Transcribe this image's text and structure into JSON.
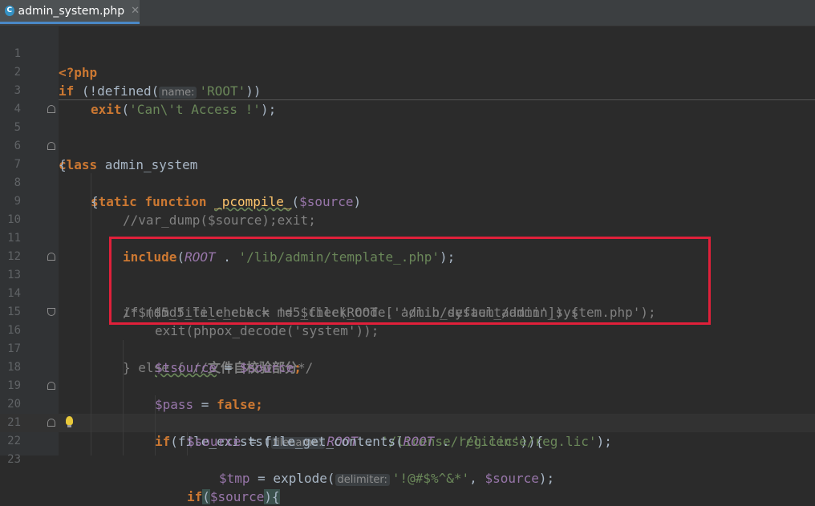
{
  "tab": {
    "filename": "admin_system.php",
    "icon_letter": "C"
  },
  "line_numbers": [
    "1",
    "2",
    "3",
    "4",
    "5",
    "6",
    "7",
    "8",
    "9",
    "10",
    "11",
    "12",
    "13",
    "14",
    "15",
    "16",
    "17",
    "18",
    "19",
    "20",
    "21",
    "22",
    "23"
  ],
  "code": {
    "l1": "<?php",
    "l2_if": "if",
    "l2_a": " (!defined(",
    "l2_hint": "name:",
    "l2_s": "'ROOT'",
    "l2_b": "))",
    "l3_exit": "exit",
    "l3_a": "(",
    "l3_s": "'Can\\'t Access !'",
    "l3_b": ");",
    "l5_class": "class",
    "l5_name": " admin_system",
    "l6": "{",
    "l7_static": "static",
    "l7_function": "function",
    "l7_name": "_pcompile_",
    "l7_a": "(",
    "l7_v": "$source",
    "l7_b": ")",
    "l8": "{",
    "l9": "//var_dump($source);exit;",
    "l11_include": "include",
    "l11_a": "(",
    "l11_root": "ROOT",
    "l11_b": " . ",
    "l11_s": "'/lib/admin/template_.php'",
    "l11_c": ");",
    "l13": "/*$md5_file_check = md5_file(ROOT . '/lib/default/admin_system.php');",
    "l14": "if ($md5_file_check != $check_code['admin_system_admin']) {",
    "l15": "exit(phpox_decode('system'));",
    "l16_a": "} else { //",
    "l16_b": "文件自校验部分",
    "l16_c": "*/",
    "l17_v1": "$tsource",
    "l17_a": " = ",
    "l17_v2": "$source",
    "l17_b": ";",
    "l19_v": "$pass",
    "l19_a": " = ",
    "l19_false": "false",
    "l19_b": ";",
    "l20_if": "if",
    "l20_a": "(file_exists(",
    "l20_hint": "filename:",
    "l20_root": "ROOT",
    "l20_b": " . ",
    "l20_s": "'/license/reg.lic'",
    "l20_c": ")){",
    "l21_v": "$source",
    "l21_a": " = file_get_contents(",
    "l21_root": "ROOT",
    "l21_b": " . ",
    "l21_s": "'/license/reg.lic'",
    "l21_c": ");",
    "l22_if": "if",
    "l22_a": "(",
    "l22_v": "$source",
    "l22_b": "){",
    "l23_v1": "$tmp",
    "l23_a": " = explode(",
    "l23_hint": "delimiter:",
    "l23_s": "'!@#$%^&*'",
    "l23_b": ", ",
    "l23_v2": "$source",
    "l23_c": ");"
  },
  "colors": {
    "background": "#2b2b2b",
    "keyword": "#cc7832",
    "string": "#6a8759",
    "variable": "#9876aa",
    "comment": "#808080",
    "function_decl": "#ffc66d",
    "highlight_box": "#e0203a"
  }
}
